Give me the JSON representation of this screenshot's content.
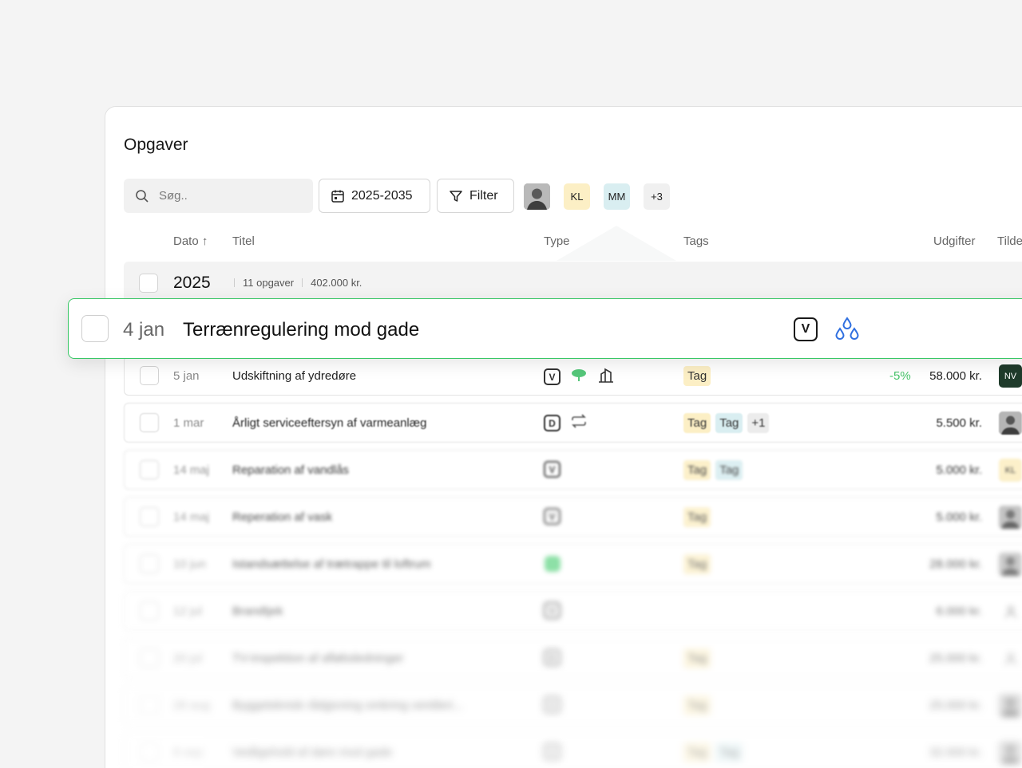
{
  "page": {
    "title": "Opgaver"
  },
  "toolbar": {
    "search_placeholder": "Søg..",
    "date_range": "2025-2035",
    "filter_label": "Filter",
    "avatars": [
      {
        "type": "photo",
        "initials": ""
      },
      {
        "type": "initials",
        "initials": "KL",
        "color": "#fcefc5"
      },
      {
        "type": "initials",
        "initials": "MM",
        "color": "#d9eef1"
      },
      {
        "type": "more",
        "initials": "+3"
      }
    ]
  },
  "table": {
    "headers": {
      "date": "Dato ↑",
      "title": "Titel",
      "type": "Type",
      "tags": "Tags",
      "expenses": "Udgifter",
      "assigned": "Tilde"
    }
  },
  "group": {
    "year": "2025",
    "task_count": "11 opgaver",
    "total": "402.000 kr."
  },
  "highlight": {
    "date": "4 jan",
    "title": "Terrænregulering mod gade",
    "type_icon": "V",
    "extra_icon": "drops-icon"
  },
  "rows": [
    {
      "date": "5 jan",
      "title": "Udskiftning af ydredøre",
      "types": [
        "V",
        "tree-icon",
        "building-icon"
      ],
      "tags": [
        "Tag"
      ],
      "pct": "-5%",
      "cost": "58.000 kr.",
      "assignee": "NV"
    },
    {
      "date": "1 mar",
      "title": "Årligt serviceeftersyn af varmeanlæg",
      "types": [
        "D",
        "repeat-icon"
      ],
      "tags": [
        "Tag",
        "Tag",
        "+1"
      ],
      "pct": "",
      "cost": "5.500 kr.",
      "assignee": "photo"
    },
    {
      "date": "14 maj",
      "title": "Reparation af vandlås",
      "types": [
        "V"
      ],
      "tags": [
        "Tag",
        "Tag"
      ],
      "pct": "",
      "cost": "5.000 kr.",
      "assignee": "KL"
    },
    {
      "date": "14 maj",
      "title": "Reperation af vask",
      "types": [
        "V"
      ],
      "tags": [
        "Tag"
      ],
      "pct": "",
      "cost": "5.000 kr.",
      "assignee": "photo"
    },
    {
      "date": "10 jun",
      "title": "Istandsættelse af trætrappe til loftrum",
      "types": [
        "check"
      ],
      "tags": [
        "Tag"
      ],
      "pct": "",
      "cost": "28.000 kr.",
      "assignee": "photo"
    },
    {
      "date": "12 jul",
      "title": "Brandtjek",
      "types": [
        "V"
      ],
      "tags": [],
      "pct": "",
      "cost": "6.000 kr.",
      "assignee": "person"
    },
    {
      "date": "20 jul",
      "title": "TV-inspektion af afløbsledninger",
      "types": [
        "D"
      ],
      "tags": [
        "Tag"
      ],
      "pct": "",
      "cost": "25.000 kr.",
      "assignee": "person"
    },
    {
      "date": "28 aug",
      "title": "Byggeteknisk rådgivning omkring ventileri...",
      "types": [
        "V"
      ],
      "tags": [
        "Tag"
      ],
      "pct": "",
      "cost": "25.000 kr.",
      "assignee": "photo"
    },
    {
      "date": "8 sep",
      "title": "Vedligehold af døre mod gade",
      "types": [
        "V"
      ],
      "tags": [
        "Tag",
        "Tag"
      ],
      "pct": "",
      "cost": "32.000 kr.",
      "assignee": "photo"
    }
  ]
}
